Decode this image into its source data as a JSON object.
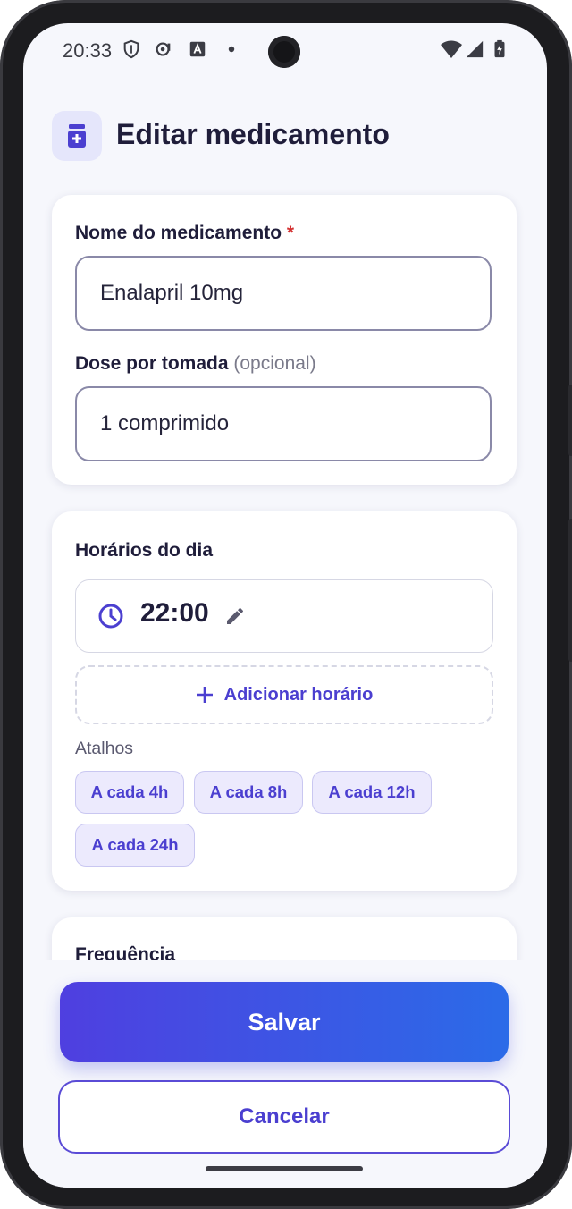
{
  "status_bar": {
    "time": "20:33"
  },
  "header": {
    "title": "Editar medicamento",
    "icon": "medicine-bottle-icon"
  },
  "medication_card": {
    "name_label": "Nome do medicamento",
    "required_mark": "*",
    "name_value": "Enalapril 10mg",
    "dose_label": "Dose por tomada",
    "dose_optional": "(opcional)",
    "dose_value": "1 comprimido"
  },
  "schedule_card": {
    "title": "Horários do dia",
    "times": [
      {
        "value": "22:00"
      }
    ],
    "add_label": "Adicionar horário",
    "shortcuts_label": "Atalhos",
    "shortcuts": [
      "A cada 4h",
      "A cada 8h",
      "A cada 12h",
      "A cada 24h"
    ]
  },
  "frequency_card": {
    "title": "Frequência"
  },
  "actions": {
    "save_label": "Salvar",
    "cancel_label": "Cancelar"
  },
  "colors": {
    "accent": "#4b3fd0",
    "gradient_start": "#4f3fe0",
    "gradient_end": "#2b6be8",
    "background": "#f6f7fc"
  }
}
